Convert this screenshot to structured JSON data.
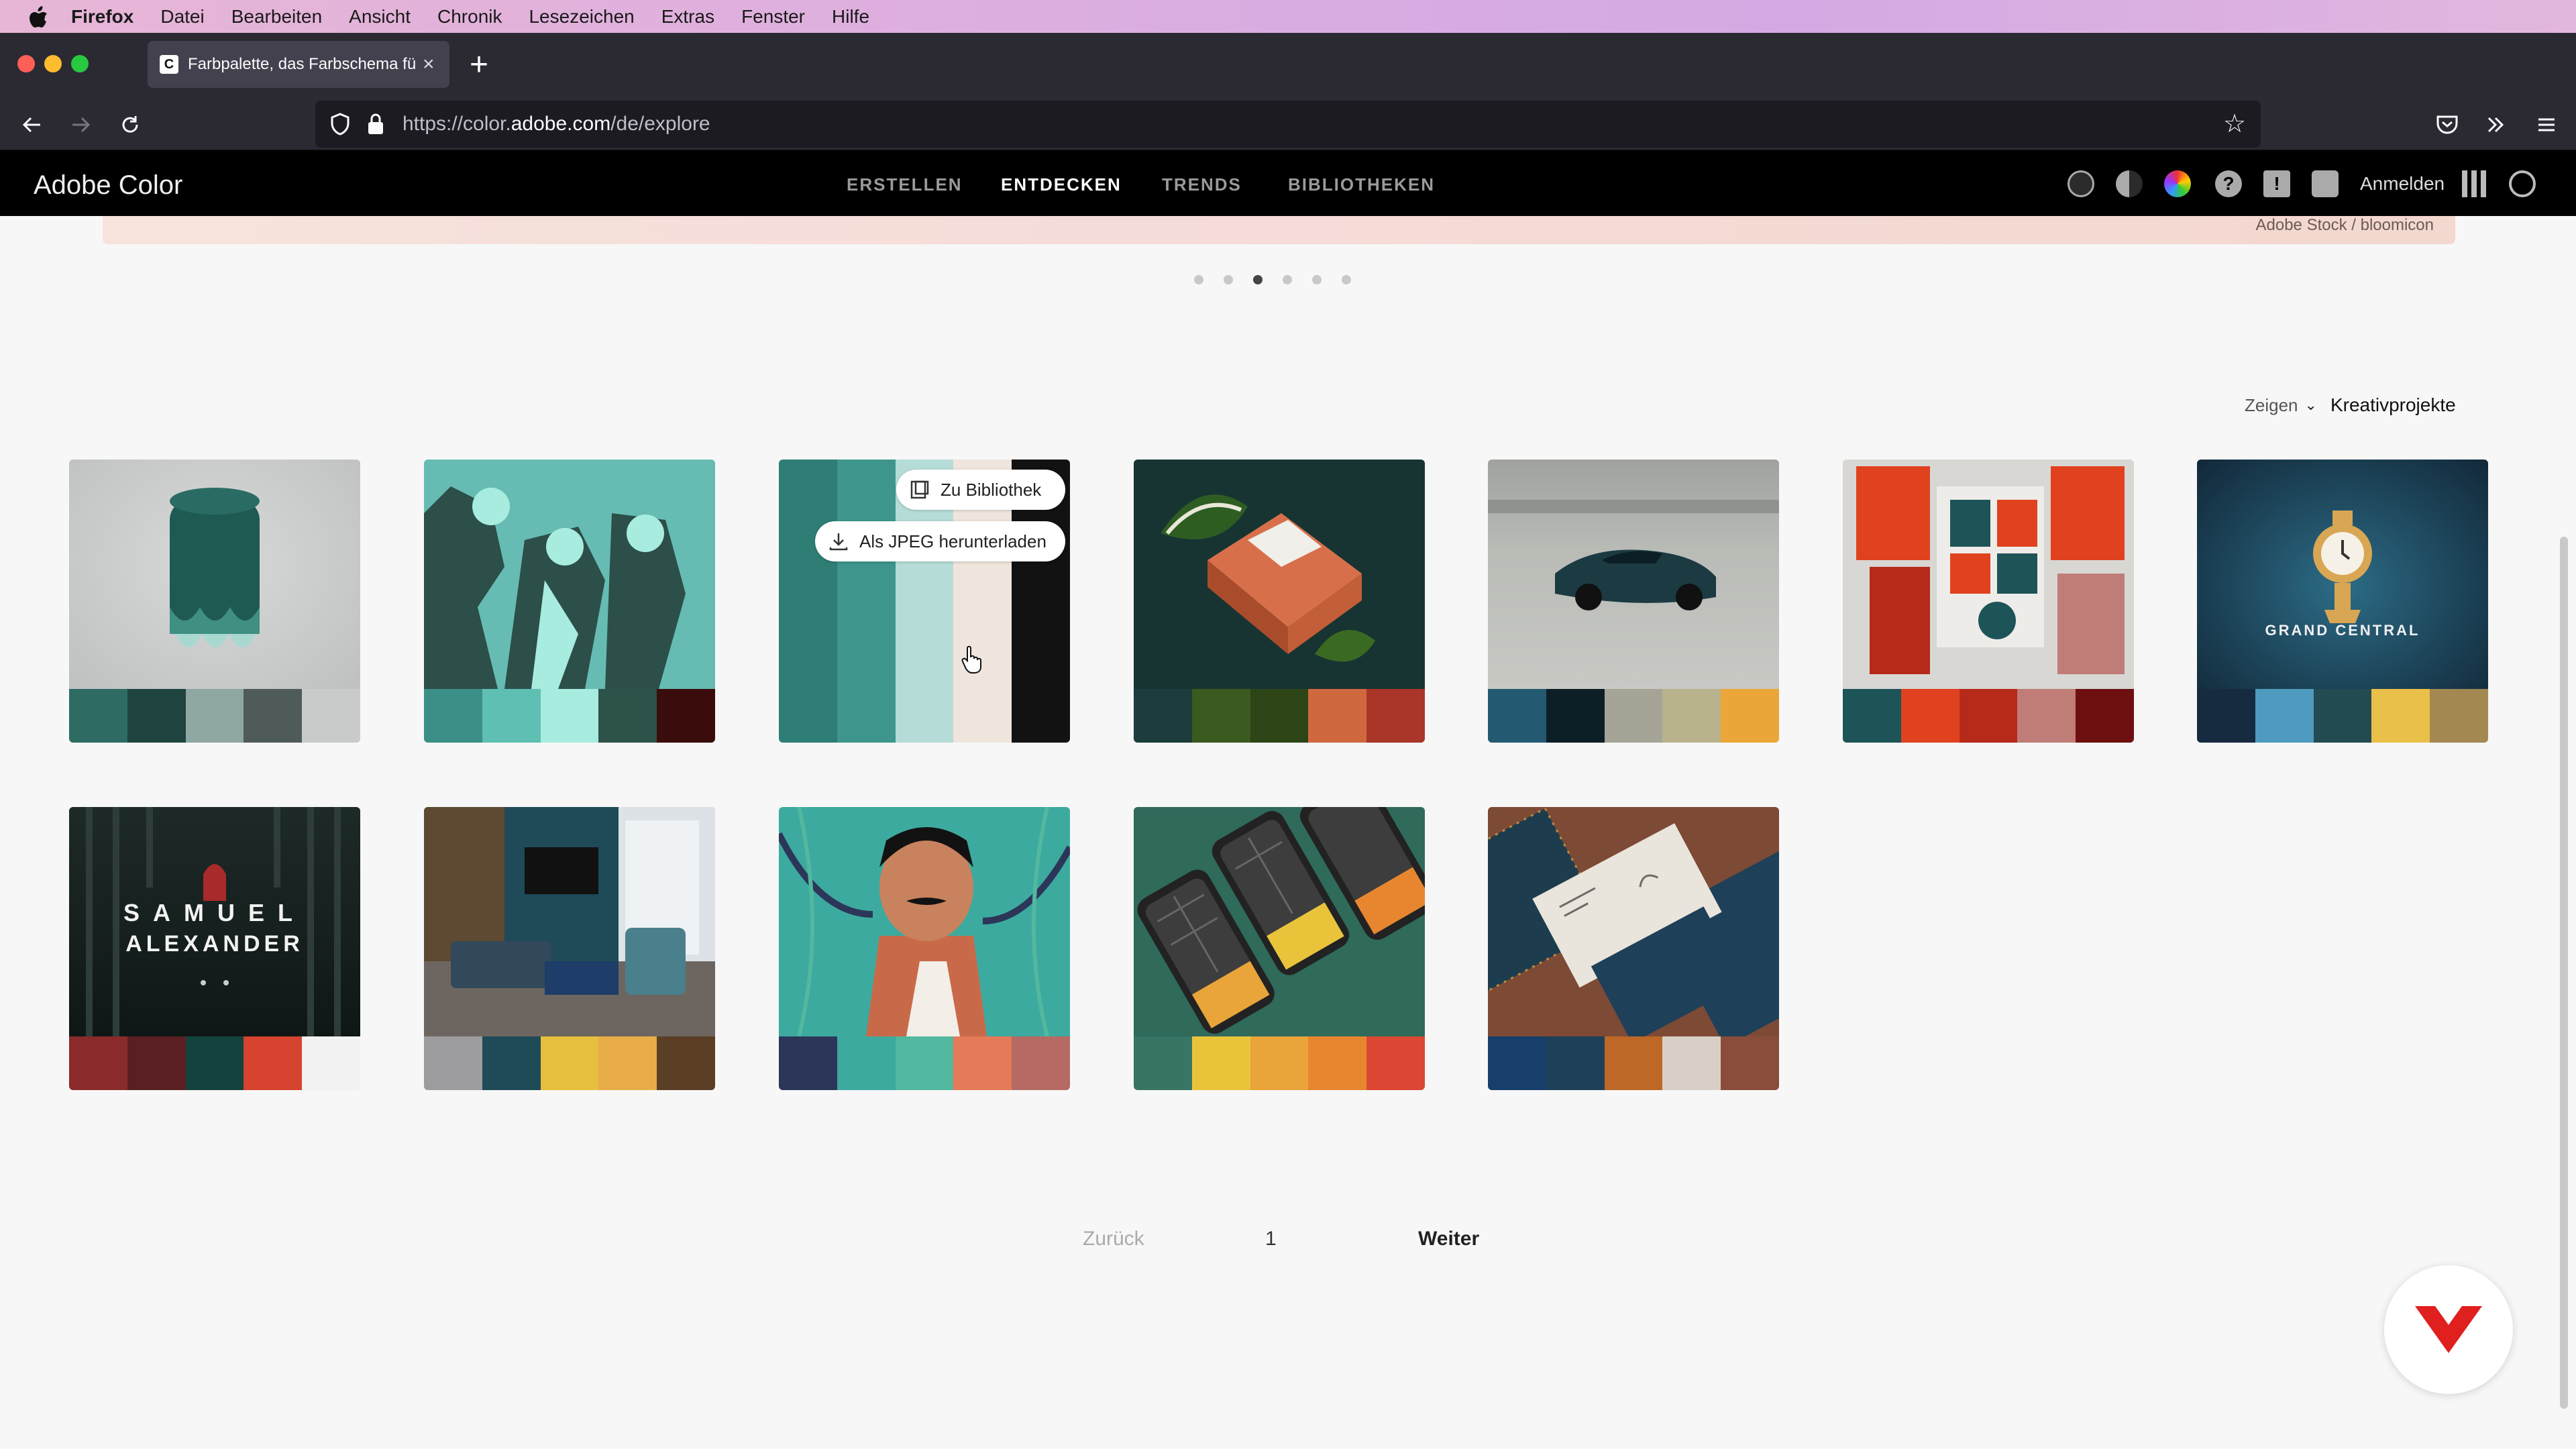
{
  "menubar": {
    "app": "Firefox",
    "items": [
      "Datei",
      "Bearbeiten",
      "Ansicht",
      "Chronik",
      "Lesezeichen",
      "Extras",
      "Fenster",
      "Hilfe"
    ]
  },
  "browser": {
    "tab_title": "Farbpalette, das Farbschema fü",
    "tab_favicon": "C",
    "url_prefix": "https://color.",
    "url_domain": "adobe.com",
    "url_path": "/de/explore"
  },
  "app": {
    "brand": "Adobe Color",
    "nav": [
      "ERSTELLEN",
      "ENTDECKEN",
      "TRENDS",
      "BIBLIOTHEKEN"
    ],
    "active_nav": "ENTDECKEN",
    "signin": "Anmelden"
  },
  "banner": {
    "credit": "Adobe Stock / bloomicon"
  },
  "carousel": {
    "active_index": 2,
    "total": 6
  },
  "filter": {
    "label": "Zeigen",
    "value": "Kreativprojekte"
  },
  "hover_actions": {
    "library": "Zu Bibliothek",
    "download": "Als JPEG herunterladen"
  },
  "cards": [
    {
      "name": "stool",
      "swatches": [
        "#2e6b63",
        "#1f4440",
        "#8fa7a3",
        "#4f5b5b",
        "#c9cbcb"
      ]
    },
    {
      "name": "band-illustration",
      "swatches": [
        "#3c8f86",
        "#5ebfb2",
        "#a8ecdf",
        "#2d524a",
        "#3a0c0c"
      ]
    },
    {
      "name": "palette-hovered",
      "swatches": [
        "#2e7e76",
        "#3e958b",
        "#b6dcd8",
        "#efe5dc",
        "#121212"
      ]
    },
    {
      "name": "salt-block",
      "swatches": [
        "#1d3c3c",
        "#3a5a1f",
        "#2c4416",
        "#d0683f",
        "#a93628"
      ]
    },
    {
      "name": "sports-car",
      "swatches": [
        "#245a71",
        "#0d1f26",
        "#a6a496",
        "#b8b38d",
        "#eba63a"
      ]
    },
    {
      "name": "calendar-graphy",
      "swatches": [
        "#1d5458",
        "#e0411f",
        "#b52a18",
        "#c07c77",
        "#6e1010"
      ]
    },
    {
      "name": "grand-central",
      "swatches": [
        "#162a40",
        "#4f9bbf",
        "#224b52",
        "#e9c049",
        "#a38852"
      ]
    },
    {
      "name": "samuel-alexander",
      "swatches": [
        "#8a2a2b",
        "#5a1f22",
        "#14423d",
        "#d6432f",
        "#f2f2f2"
      ]
    },
    {
      "name": "living-room",
      "swatches": [
        "#9d9d9f",
        "#1f4a58",
        "#e7bf3e",
        "#e8ad47",
        "#5a3f25"
      ]
    },
    {
      "name": "man-illustration",
      "swatches": [
        "#2c3659",
        "#3daa9f",
        "#52b89f",
        "#e57a59",
        "#b56a63"
      ]
    },
    {
      "name": "phones-map",
      "swatches": [
        "#387565",
        "#e9c43b",
        "#e9a43a",
        "#e8862f",
        "#db4733"
      ]
    },
    {
      "name": "business-cards",
      "swatches": [
        "#173f6b",
        "#1e4058",
        "#bd6826",
        "#d8d0c6",
        "#8a4d3b"
      ]
    }
  ],
  "pagination": {
    "prev": "Zurück",
    "page": "1",
    "next": "Weiter"
  }
}
